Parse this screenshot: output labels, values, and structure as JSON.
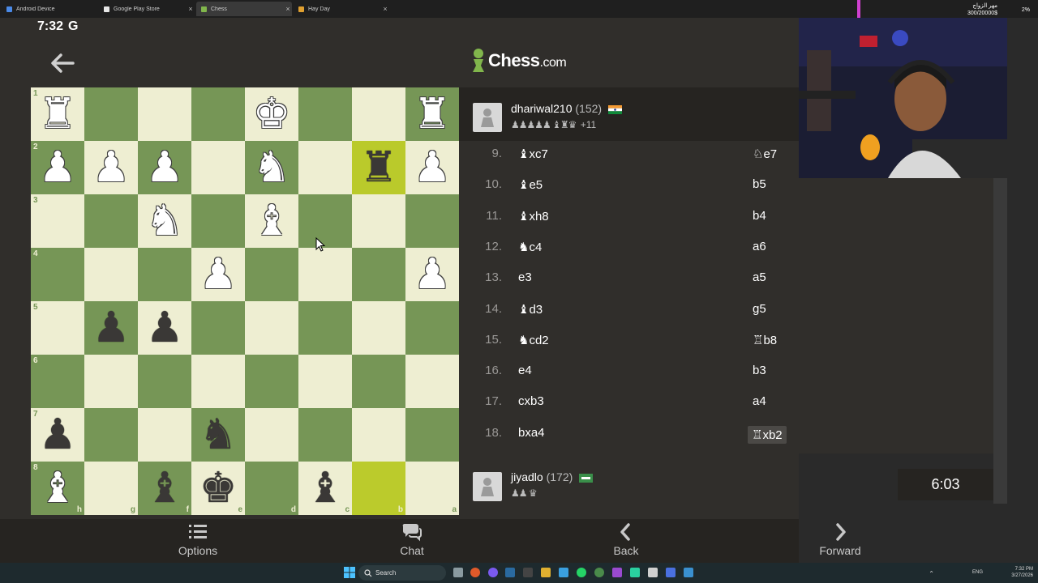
{
  "browser_tabs": [
    {
      "label": "Android Device",
      "color": "#4a8ae8"
    },
    {
      "label": "Google Play Store",
      "color": "#e8e8e8"
    },
    {
      "label": "Chess",
      "color": "#81b64c"
    },
    {
      "label": "Hay Day",
      "color": "#e0a030"
    }
  ],
  "status": {
    "time": "7:32",
    "g": "G"
  },
  "logo": {
    "brand": "Chess",
    "suffix": ".com"
  },
  "board": {
    "ranks": [
      "1",
      "2",
      "3",
      "4",
      "5",
      "6",
      "7",
      "8"
    ],
    "files": [
      "h",
      "g",
      "f",
      "e",
      "d",
      "c",
      "b",
      "a"
    ],
    "rows": [
      [
        "wR",
        "",
        "",
        "",
        "wK",
        "",
        "",
        "wR"
      ],
      [
        "wP",
        "wP",
        "wP",
        "",
        "wN",
        "",
        "bR",
        "wP"
      ],
      [
        "",
        "",
        "wN",
        "",
        "wB",
        "",
        "",
        ""
      ],
      [
        "",
        "",
        "",
        "wP",
        "",
        "",
        "",
        "wP"
      ],
      [
        "",
        "bP",
        "bP",
        "",
        "",
        "",
        "",
        ""
      ],
      [
        "",
        "",
        "",
        "",
        "",
        "",
        "",
        ""
      ],
      [
        "bP",
        "",
        "",
        "bN",
        "",
        "",
        "",
        ""
      ],
      [
        "wB",
        "",
        "bB",
        "bK",
        "",
        "bB",
        "",
        ""
      ]
    ]
  },
  "top_player": {
    "name": "dhariwal210",
    "rating": "(152)",
    "captured": "♟♟♟♟♟ ♝♜♛",
    "advantage": "+11"
  },
  "moves": [
    {
      "num": "9.",
      "white": "♝xc7",
      "black": "♘e7"
    },
    {
      "num": "10.",
      "white": "♝e5",
      "black": "b5"
    },
    {
      "num": "11.",
      "white": "♝xh8",
      "black": "b4"
    },
    {
      "num": "12.",
      "white": "♞c4",
      "black": "a6"
    },
    {
      "num": "13.",
      "white": "e3",
      "black": "a5"
    },
    {
      "num": "14.",
      "white": "♝d3",
      "black": "g5"
    },
    {
      "num": "15.",
      "white": "♞cd2",
      "black": "♖b8"
    },
    {
      "num": "16.",
      "white": "e4",
      "black": "b3"
    },
    {
      "num": "17.",
      "white": "cxb3",
      "black": "a4"
    },
    {
      "num": "18.",
      "white": "bxa4",
      "black": "♖xb2"
    }
  ],
  "bottom_player": {
    "name": "jiyadlo",
    "rating": "(172)",
    "captured": "♟♟ ♛",
    "clock": "6:03"
  },
  "nav": {
    "options": "Options",
    "chat": "Chat",
    "back": "Back",
    "forward": "Forward"
  },
  "stream_overlay": {
    "title": "مهر الزواج",
    "amount": "300/20000$",
    "percent": "2%"
  },
  "taskbar": {
    "search": "Search",
    "lang": "ENG",
    "time": "7:32 PM",
    "date": "3/27/2026"
  }
}
